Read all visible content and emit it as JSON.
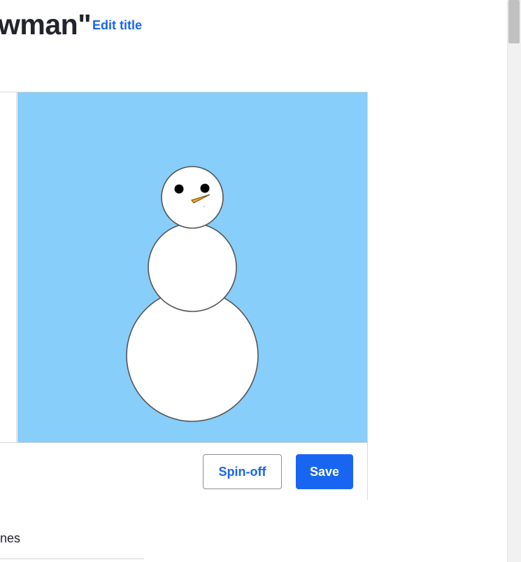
{
  "header": {
    "title": "wman\"",
    "edit_title_label": "Edit title"
  },
  "editor": {
    "canvas_background": "#87cefa",
    "scene": "snowman with black eyes and orange carrot nose"
  },
  "toolbar": {
    "spinoff_label": "Spin-off",
    "save_label": "Save",
    "accent_color": "#1865f2"
  },
  "below": {
    "section_label": "ines"
  }
}
